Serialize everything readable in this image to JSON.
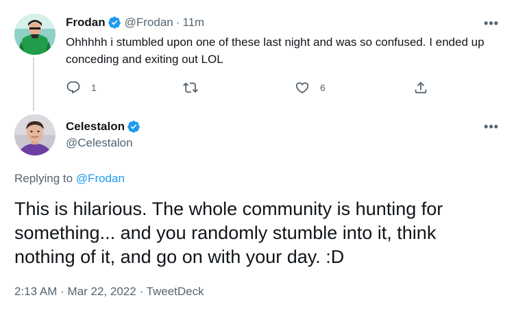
{
  "parent_tweet": {
    "display_name": "Frodan",
    "handle": "@Frodan",
    "separator": "·",
    "time_ago": "11m",
    "text": "Ohhhhh i stumbled upon one of these last night and was so confused. I ended up conceding and exiting out LOL",
    "reply_count": "1",
    "like_count": "6",
    "more_label": "•••"
  },
  "main_tweet": {
    "display_name": "Celestalon",
    "handle": "@Celestalon",
    "replying_prefix": "Replying to",
    "replying_handle": "@Frodan",
    "text": "This is hilarious. The whole community is hunting for something... and you randomly stumble into it, think nothing of it, and go on with your day. :D",
    "time": "2:13 AM",
    "separator": "·",
    "date": "Mar 22, 2022",
    "source": "TweetDeck",
    "more_label": "•••"
  },
  "icons": {
    "verified": "verified-badge-icon",
    "reply": "reply-icon",
    "retweet": "retweet-icon",
    "like": "like-heart-icon",
    "share": "share-icon",
    "more": "more-options-icon"
  },
  "colors": {
    "accent": "#1d9bf0",
    "text_primary": "#0f1419",
    "text_secondary": "#536471",
    "thread_line": "#cfd9de"
  }
}
